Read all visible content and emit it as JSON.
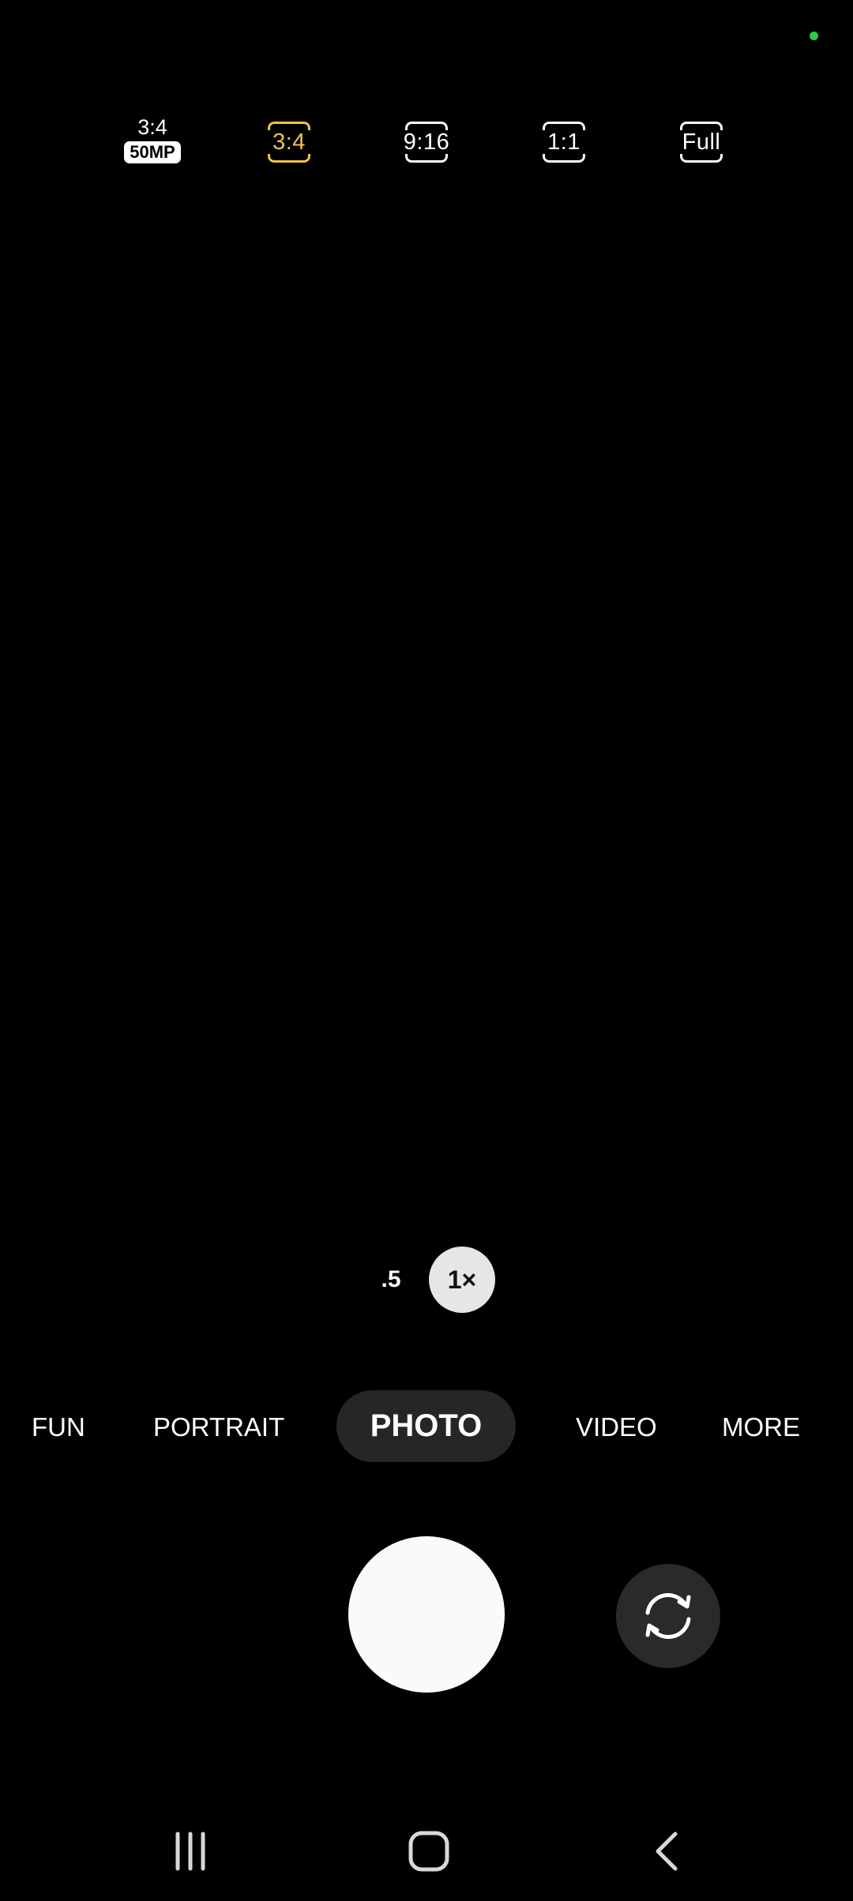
{
  "colors": {
    "background": "#000000",
    "selected_accent": "#f0c34a",
    "privacy_dot": "#2ecc40",
    "active_mode_pill": "#262626"
  },
  "aspect_ratios": {
    "high_res": {
      "ratio": "3:4",
      "badge": "50MP"
    },
    "items": [
      {
        "label": "3:4",
        "selected": true
      },
      {
        "label": "9:16",
        "selected": false
      },
      {
        "label": "1:1",
        "selected": false
      },
      {
        "label": "Full",
        "selected": false
      }
    ]
  },
  "zoom": {
    "wide_label": ".5",
    "current_label": "1×"
  },
  "modes": {
    "fun": "FUN",
    "portrait": "PORTRAIT",
    "photo": "PHOTO",
    "video": "VIDEO",
    "more": "MORE",
    "active": "PHOTO"
  },
  "icons": {
    "flip_camera": "flip-camera-icon",
    "recent_apps": "recent-apps-icon",
    "home": "home-icon",
    "back": "back-icon"
  }
}
